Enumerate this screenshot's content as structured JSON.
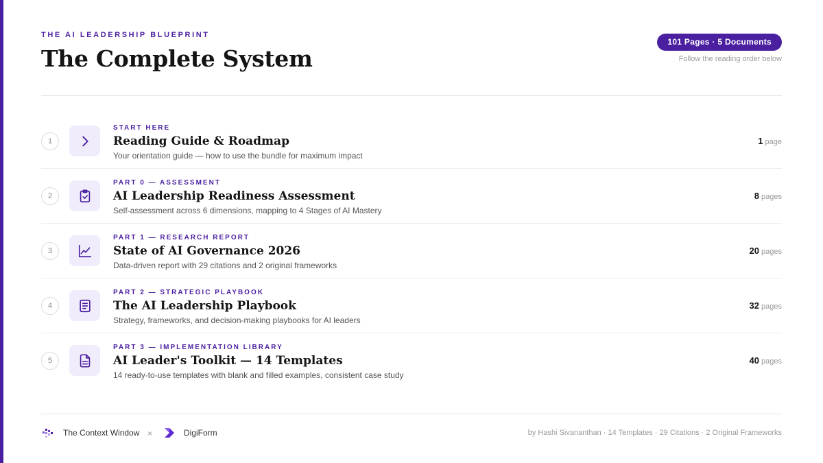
{
  "header": {
    "eyebrow": "THE AI LEADERSHIP BLUEPRINT",
    "title": "The Complete System",
    "badge": "101 Pages · 5 Documents",
    "badge_sub": "Follow the reading order below"
  },
  "items": [
    {
      "num": "1",
      "icon": "chevron-right-icon",
      "label": "START HERE",
      "title": "Reading Guide & Roadmap",
      "desc": "Your orientation guide — how to use the bundle for maximum impact",
      "pages": "1",
      "unit": "page"
    },
    {
      "num": "2",
      "icon": "clipboard-check-icon",
      "label": "PART 0 — ASSESSMENT",
      "title": "AI Leadership Readiness Assessment",
      "desc": "Self-assessment across 6 dimensions, mapping to 4 Stages of AI Mastery",
      "pages": "8",
      "unit": "pages"
    },
    {
      "num": "3",
      "icon": "line-chart-icon",
      "label": "PART 1 — RESEARCH REPORT",
      "title": "State of AI Governance 2026",
      "desc": "Data-driven report with 29 citations and 2 original frameworks",
      "pages": "20",
      "unit": "pages"
    },
    {
      "num": "4",
      "icon": "book-icon",
      "label": "PART 2 — STRATEGIC PLAYBOOK",
      "title": "The AI Leadership Playbook",
      "desc": "Strategy, frameworks, and decision-making playbooks for AI leaders",
      "pages": "32",
      "unit": "pages"
    },
    {
      "num": "5",
      "icon": "document-icon",
      "label": "PART 3 — IMPLEMENTATION LIBRARY",
      "title": "AI Leader's Toolkit — 14 Templates",
      "desc": "14 ready-to-use templates with blank and filled examples, consistent case study",
      "pages": "40",
      "unit": "pages"
    }
  ],
  "footer": {
    "brand1": "The Context Window",
    "times": "×",
    "brand2": "DigiForm",
    "credits": "by Hashi Sivananthan · 14 Templates · 29 Citations · 2 Original Frameworks"
  },
  "colors": {
    "accent": "#4a1fa0",
    "icon_bg": "#f1ecfb"
  }
}
